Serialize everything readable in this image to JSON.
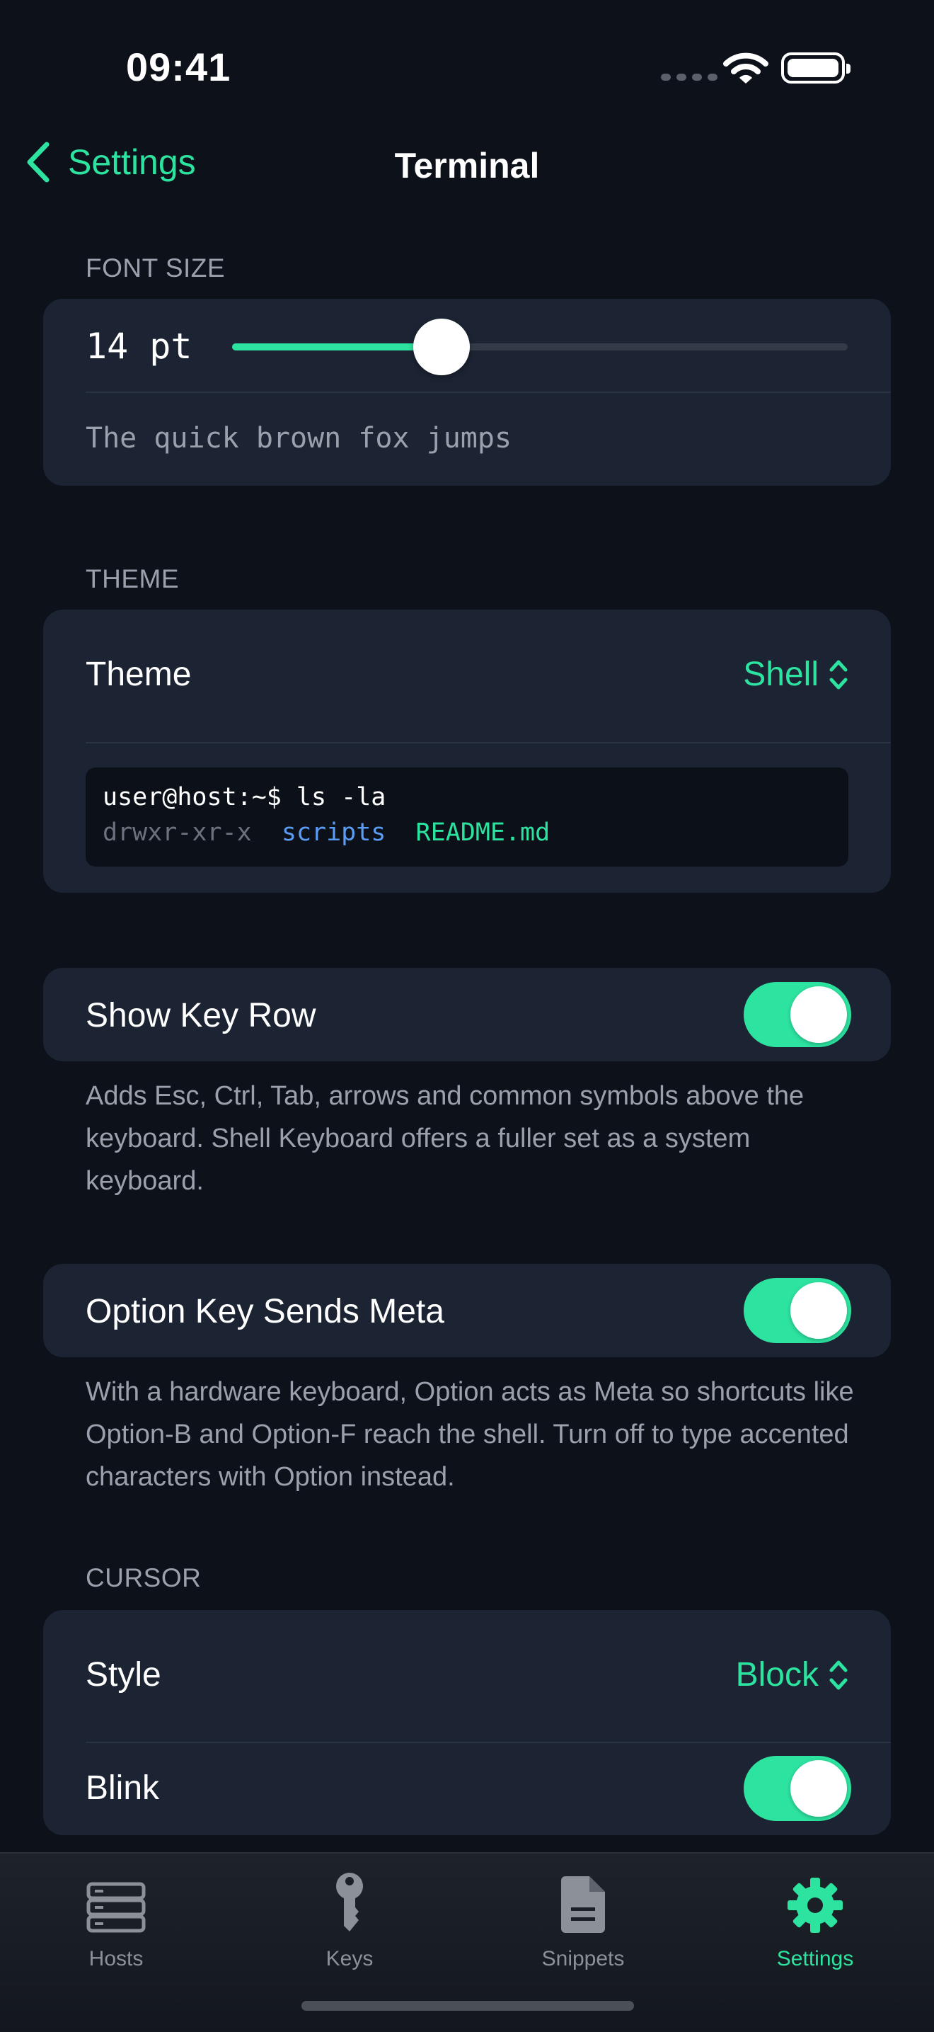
{
  "status_bar": {
    "time": "09:41"
  },
  "nav": {
    "back_label": "Settings",
    "title": "Terminal"
  },
  "font_size": {
    "header": "FONT SIZE",
    "value_label": "14 pt",
    "slider_fraction": 0.34,
    "preview_text": "The quick brown fox jumps"
  },
  "theme": {
    "header": "THEME",
    "row_label": "Theme",
    "value": "Shell",
    "preview": {
      "prompt": "user@host:~$ ls -la",
      "perms": "drwxr-xr-x",
      "dir": "scripts",
      "file": "README.md"
    }
  },
  "key_row": {
    "label": "Show Key Row",
    "enabled": true,
    "footnote": "Adds Esc, Ctrl, Tab, arrows and common symbols above the keyboard. Shell Keyboard offers a fuller set as a system keyboard."
  },
  "option_meta": {
    "label": "Option Key Sends Meta",
    "enabled": true,
    "footnote": "With a hardware keyboard, Option acts as Meta so shortcuts like Option-B and Option-F reach the shell. Turn off to type accented characters with Option instead."
  },
  "cursor": {
    "header": "CURSOR",
    "style_label": "Style",
    "style_value": "Block",
    "blink_label": "Blink",
    "blink_enabled": true
  },
  "tabbar": {
    "tabs": [
      {
        "label": "Hosts",
        "icon": "server-icon"
      },
      {
        "label": "Keys",
        "icon": "key-icon"
      },
      {
        "label": "Snippets",
        "icon": "document-icon"
      },
      {
        "label": "Settings",
        "icon": "gear-icon"
      }
    ],
    "active_index": 3
  },
  "colors": {
    "accent": "#2de3a0",
    "background": "#0c111a",
    "card": "#1c2433",
    "secondary_text": "#9aa1ac",
    "term_directory": "#5b9cf5",
    "term_file": "#2de3a0"
  }
}
